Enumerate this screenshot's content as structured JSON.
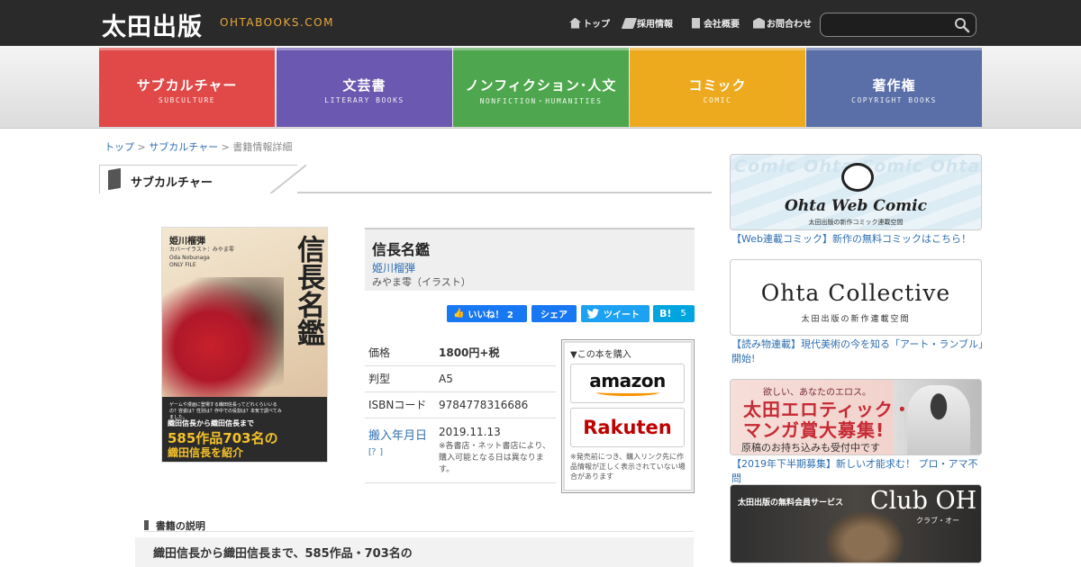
{
  "header": {
    "logo": "太田出版",
    "logo_sub": "OHTABOOKS.COM",
    "nav": [
      "トップ",
      "採用情報",
      "会社概要",
      "お問合わせ"
    ],
    "search_placeholder": ""
  },
  "categories": [
    {
      "jp": "サブカルチャー",
      "en": "SUBCULTURE",
      "color": "#e14848"
    },
    {
      "jp": "文芸書",
      "en": "LITERARY BOOKS",
      "color": "#6b58b0"
    },
    {
      "jp": "ノンフィクション･人文",
      "en": "NONFICTION・HUMANITIES",
      "color": "#4ea74e"
    },
    {
      "jp": "コミック",
      "en": "COMIC",
      "color": "#eeaa1f"
    },
    {
      "jp": "著作権",
      "en": "COPYRIGHT BOOKS",
      "color": "#5a6ea8"
    }
  ],
  "breadcrumb": {
    "home": "トップ",
    "sep": ">",
    "category": "サブカルチャー",
    "current": "書籍情報詳細"
  },
  "section_title": "サブカルチャー",
  "cover": {
    "author": "姫川榴弾",
    "illus": "カバーイラスト：みやま零",
    "en": "Oda Nobunaga ONLY FILE",
    "title": "信長名鑑",
    "small": "ゲームや漫画に登場する織田信長ってどれくらいいるの？容姿は？性別は？作中での役割は？本気で調べてみました。",
    "band1": "織田信長から織田信長まで",
    "band2": "585作品703名の",
    "band3": "織田信長を紹介"
  },
  "book": {
    "title": "信長名鑑",
    "author": "姫川榴弾",
    "illustrator": "みやま零（イラスト）"
  },
  "sns": {
    "like": "いいね！ 2",
    "share": "シェア",
    "tweet": "ツイート",
    "hatena": "B!",
    "hatena_count": "5"
  },
  "spec": {
    "price_label": "価格",
    "price": "1800円+税",
    "size_label": "判型",
    "size": "A5",
    "isbn_label": "ISBNコード",
    "isbn": "9784778316686",
    "date_label": "搬入年月日",
    "date_q": "[？]",
    "date": "2019.11.13",
    "date_note": "※各書店・ネット書店により、購入可能となる日は異なります。"
  },
  "buy": {
    "title": "▼この本を購入",
    "amazon": "amazon",
    "rakuten": "Rakuten",
    "note": "※発売前につき、購入リンク先に作品情報が正しく表示されていない場合があります"
  },
  "description": {
    "heading": "書籍の説明",
    "text": "織田信長から織田信長まで、585作品・703名の"
  },
  "sidebar": [
    {
      "caption": "【Web連載コミック】新作の無料コミックはこちら！",
      "logo": "Ohta Web Comic",
      "sub": "太田出版の新作コミック連載空間",
      "bg": "Comic Ohta Comic Ohta Comic"
    },
    {
      "caption": "【読み物連載】現代美術の今を知る「アート・ランブル」開始!",
      "logo": "Ohta Collective",
      "sub": "太田出版の新作連載空間"
    },
    {
      "caption": "【2019年下半期募集】新しい才能求む！ プロ・アマ不問",
      "t1": "欲しい、あなたのエロス。",
      "t2": "太田エロティック・",
      "t3": "マンガ賞大募集!",
      "t4": "原稿のお持ち込みも受付中です"
    },
    {
      "caption": "",
      "t1": "太田出版の無料会員サービス",
      "t2": "Club OH",
      "t3": "クラブ・オー"
    }
  ]
}
